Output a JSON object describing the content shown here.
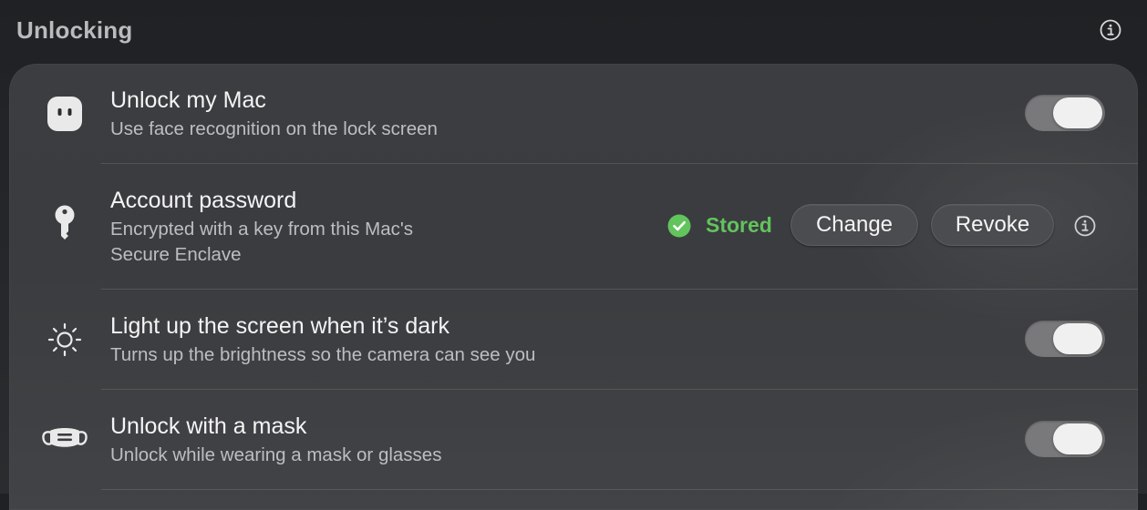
{
  "header": {
    "title": "Unlocking",
    "info_icon": "info-circle-icon"
  },
  "rows": [
    {
      "icon": "face-id-icon",
      "title": "Unlock my Mac",
      "subtitle": "Use face recognition on the lock screen",
      "toggle_on": true
    },
    {
      "icon": "key-icon",
      "title": "Account password",
      "subtitle_line1": "Encrypted with a key from this Mac's",
      "subtitle_line2": "Secure Enclave",
      "status_icon": "checkmark-circle-icon",
      "status_label": "Stored",
      "change_label": "Change",
      "revoke_label": "Revoke",
      "info_icon": "info-circle-icon"
    },
    {
      "icon": "sun-icon",
      "title": "Light up the screen when it’s dark",
      "subtitle": "Turns up the brightness so the camera can see you",
      "toggle_on": true
    },
    {
      "icon": "mask-icon",
      "title": "Unlock with a mask",
      "subtitle": "Unlock while wearing a mask or glasses",
      "toggle_on": true
    }
  ],
  "colors": {
    "status_green": "#63c35d",
    "toggle_track": "#79797b",
    "panel": "#3b3d40"
  }
}
